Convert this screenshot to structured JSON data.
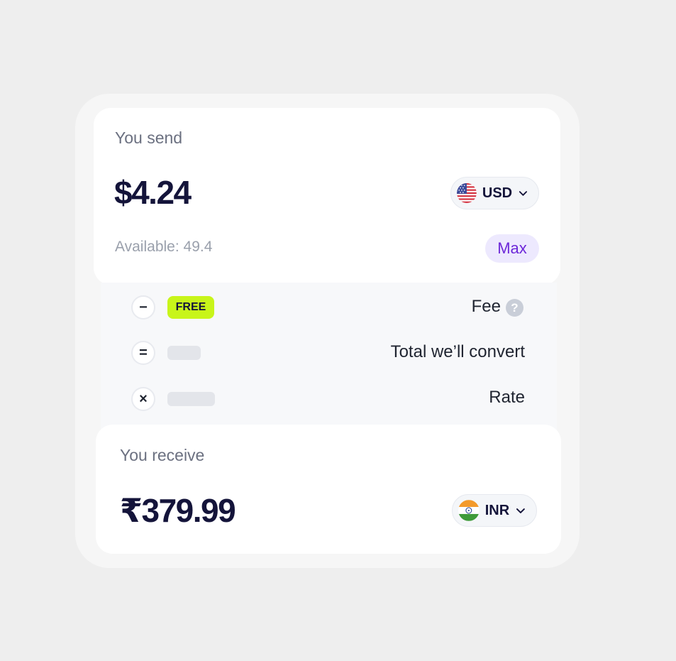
{
  "send": {
    "label": "You send",
    "amount": "$4.24",
    "currency": {
      "code": "USD",
      "flag_icon": "us-flag-icon"
    },
    "available": "Available: 49.4",
    "max_label": "Max"
  },
  "breakdown": {
    "fee": {
      "symbol": "−",
      "badge": "FREE",
      "label": "Fee",
      "help": "?"
    },
    "total": {
      "symbol": "=",
      "label": "Total we’ll convert"
    },
    "rate": {
      "symbol": "×",
      "label": "Rate"
    }
  },
  "receive": {
    "label": "You receive",
    "amount": "₹379.99",
    "currency": {
      "code": "INR",
      "flag_icon": "india-flag-icon"
    }
  },
  "colors": {
    "accent": "#6d28d9",
    "badge_green": "#c8f51a",
    "text_dark": "#14143a"
  }
}
